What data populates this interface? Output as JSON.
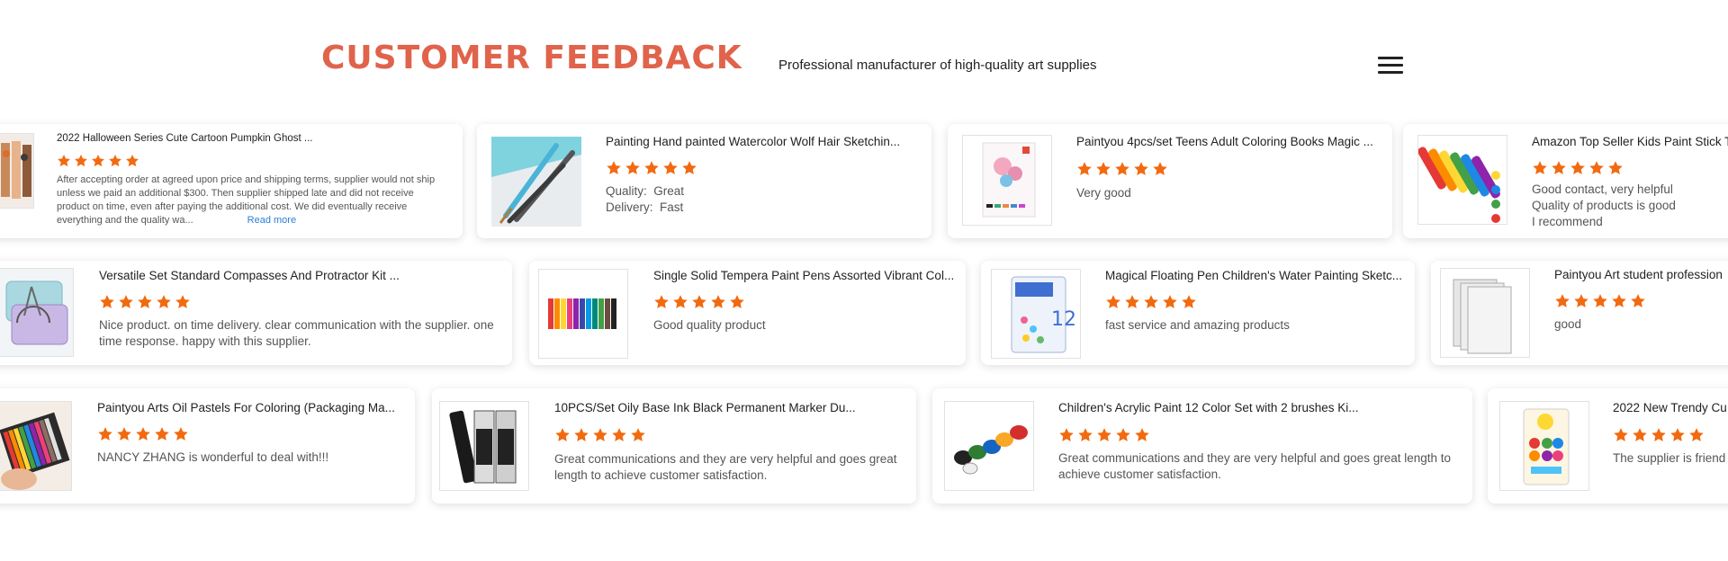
{
  "header": {
    "title": "CUSTOMER FEEDBACK",
    "subtitle": "Professional manufacturer of high-quality art supplies",
    "menu_icon": "hamburger-menu-icon"
  },
  "colors": {
    "accent": "#e0634b",
    "star": "#f26a10",
    "link": "#2a7fd4"
  },
  "rating_max": 5,
  "reviews": [
    {
      "product": "2022 Halloween Series Cute Cartoon Pumpkin Ghost ...",
      "rating": 5,
      "text": "After accepting order at agreed upon price and shipping terms, supplier would not ship unless we paid an additional $300. Then supplier shipped late and did not receive product on time, even after paying the additional cost. We did eventually receive everything and the quality wa...",
      "read_more": "Read more"
    },
    {
      "product": "Painting Hand painted Watercolor Wolf Hair Sketchin...",
      "rating": 5,
      "quality_label": "Quality:",
      "quality_value": "Great",
      "delivery_label": "Delivery:",
      "delivery_value": "Fast"
    },
    {
      "product": "Paintyou 4pcs/set Teens Adult Coloring Books Magic ...",
      "rating": 5,
      "text": "Very good"
    },
    {
      "product": "Amazon Top Seller Kids Paint Stick T",
      "rating": 5,
      "lines": [
        "Good contact, very helpful",
        "Quality of products is good",
        "I recommend"
      ]
    },
    {
      "product": "Versatile Set Standard Compasses And Protractor Kit ...",
      "rating": 5,
      "text": "Nice product. on time delivery. clear communication with the supplier. one time response. happy with this supplier."
    },
    {
      "product": "Single Solid Tempera Paint Pens Assorted Vibrant Col...",
      "rating": 5,
      "text": "Good quality product"
    },
    {
      "product": "Magical Floating Pen Children's Water Painting Sketc...",
      "rating": 5,
      "text": "fast service and amazing products"
    },
    {
      "product": "Paintyou Art student profession",
      "rating": 5,
      "text": "good"
    },
    {
      "product": "Paintyou Arts Oil Pastels For Coloring (Packaging Ma...",
      "rating": 5,
      "text": "NANCY ZHANG is wonderful to deal with!!!"
    },
    {
      "product": "10PCS/Set Oily Base Ink Black Permanent Marker Du...",
      "rating": 5,
      "text": "Great communications and they are very helpful and goes great length to achieve customer satisfaction."
    },
    {
      "product": "Children's Acrylic Paint 12 Color Set with 2 brushes Ki...",
      "rating": 5,
      "text": "Great communications and they are very helpful and goes great length to achieve customer satisfaction."
    },
    {
      "product": "2022 New Trendy Cu",
      "rating": 5,
      "text": "The supplier is friend"
    }
  ]
}
